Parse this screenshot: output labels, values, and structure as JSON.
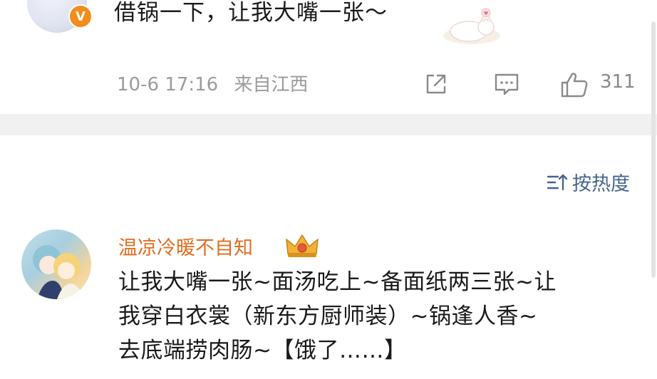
{
  "post": {
    "text": "借锅一下，让我大嘴一张～",
    "verified_mark": "V",
    "timestamp": "10-6 17:16",
    "location": "来自江西",
    "like_count": "311",
    "icons": [
      "share-icon",
      "comment-icon",
      "like-icon"
    ]
  },
  "sort": {
    "label": "按热度",
    "icon": "sort-icon"
  },
  "comment": {
    "username": "温凉冷暖不自知",
    "badge_icon": "crown-icon",
    "lines": [
      "让我大嘴一张~面汤吃上~备面纸两三张~让",
      "我穿白衣裳（新东方厨师装）~锅逢人香~",
      "去底端捞肉肠~【饿了……】"
    ]
  },
  "colors": {
    "username": "#e06e21",
    "sort_link": "#47648c",
    "meta_text": "#9b9b9b",
    "verified_badge": "#f28c1a",
    "separator": "#f1f1f1"
  }
}
